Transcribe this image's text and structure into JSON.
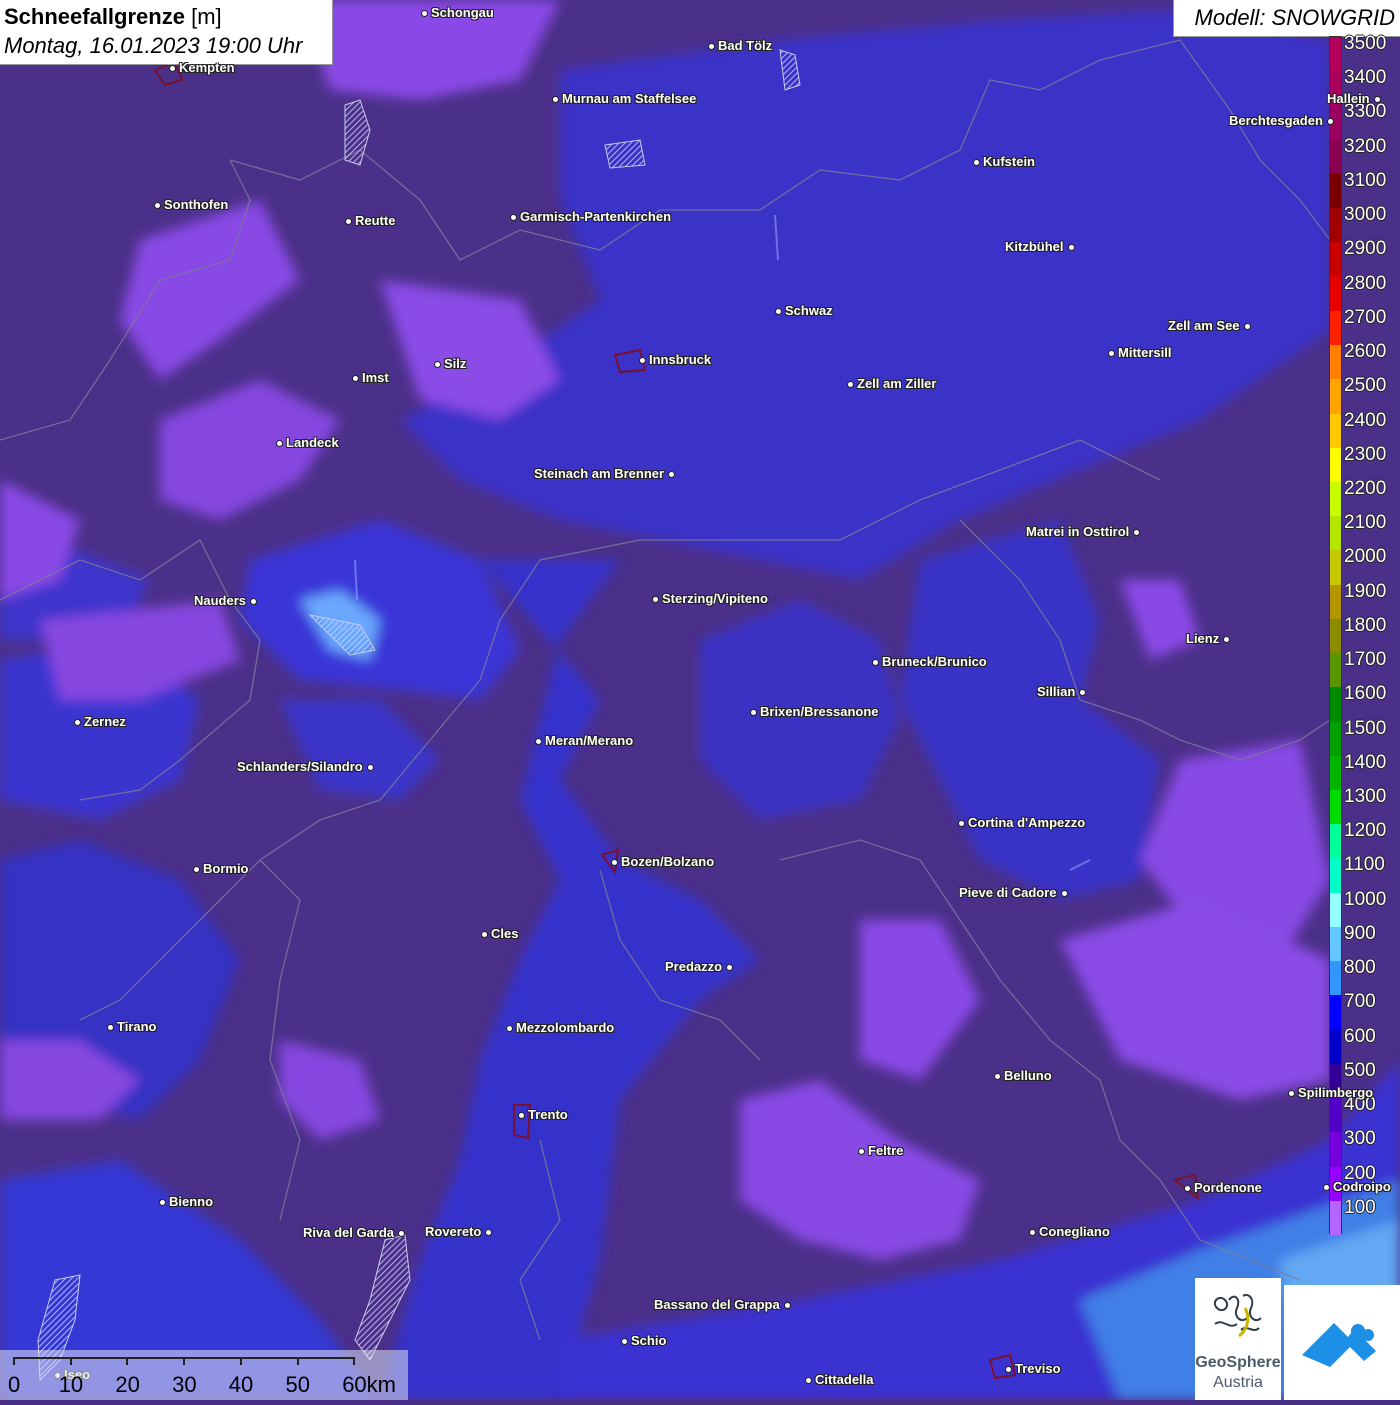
{
  "header": {
    "title_bold": "Schneefallgrenze",
    "title_unit": "[m]",
    "datetime": "Montag, 16.01.2023 19:00 Uhr"
  },
  "model_label": "Modell: SNOWGRID",
  "legend": {
    "values": [
      "3500",
      "3400",
      "3300",
      "3200",
      "3100",
      "3000",
      "2900",
      "2800",
      "2700",
      "2600",
      "2500",
      "2400",
      "2300",
      "2200",
      "2100",
      "2000",
      "1900",
      "1800",
      "1700",
      "1600",
      "1500",
      "1400",
      "1300",
      "1200",
      "1100",
      "1000",
      "900",
      "800",
      "700",
      "600",
      "500",
      "400",
      "300",
      "200",
      "100"
    ],
    "colors": [
      "#b4005a",
      "#a8005a",
      "#9a0060",
      "#8c0050",
      "#780000",
      "#a00000",
      "#c80000",
      "#e60000",
      "#ff2000",
      "#ff7f00",
      "#ffa500",
      "#ffc800",
      "#ffff00",
      "#c8ff00",
      "#b4e600",
      "#c8c800",
      "#b49600",
      "#8c8c00",
      "#5a9600",
      "#008c00",
      "#00a000",
      "#00b400",
      "#00dc00",
      "#00ff96",
      "#00ffc8",
      "#96ffff",
      "#64c8ff",
      "#3296ff",
      "#0000ff",
      "#0000c8",
      "#320096",
      "#5000c8",
      "#7800dc",
      "#9600ff",
      "#b464ff"
    ]
  },
  "cities": [
    {
      "name": "Schongau"
    },
    {
      "name": "Bad Tölz"
    },
    {
      "name": "Kempten"
    },
    {
      "name": "Murnau am Staffelsee"
    },
    {
      "name": "Hallein"
    },
    {
      "name": "Berchtesgaden"
    },
    {
      "name": "Kufstein"
    },
    {
      "name": "Sonthofen"
    },
    {
      "name": "Reutte"
    },
    {
      "name": "Garmisch-Partenkirchen"
    },
    {
      "name": "Kitzbühel"
    },
    {
      "name": "Schwaz"
    },
    {
      "name": "Zell am See"
    },
    {
      "name": "Innsbruck"
    },
    {
      "name": "Mittersill"
    },
    {
      "name": "Silz"
    },
    {
      "name": "Imst"
    },
    {
      "name": "Zell am Ziller"
    },
    {
      "name": "Landeck"
    },
    {
      "name": "Steinach am Brenner"
    },
    {
      "name": "Matrei in Osttirol"
    },
    {
      "name": "Nauders"
    },
    {
      "name": "Sterzing/Vipiteno"
    },
    {
      "name": "Lienz"
    },
    {
      "name": "Bruneck/Brunico"
    },
    {
      "name": "Sillian"
    },
    {
      "name": "Brixen/Bressanone"
    },
    {
      "name": "Zernez"
    },
    {
      "name": "Meran/Merano"
    },
    {
      "name": "Schlanders/Silandro"
    },
    {
      "name": "Cortina d'Ampezzo"
    },
    {
      "name": "Bozen/Bolzano"
    },
    {
      "name": "Bormio"
    },
    {
      "name": "Pieve di Cadore"
    },
    {
      "name": "Cles"
    },
    {
      "name": "Predazzo"
    },
    {
      "name": "Tirano"
    },
    {
      "name": "Mezzolombardo"
    },
    {
      "name": "Belluno"
    },
    {
      "name": "Spilimbergo"
    },
    {
      "name": "Trento"
    },
    {
      "name": "Feltre"
    },
    {
      "name": "Pordenone"
    },
    {
      "name": "Codroipo"
    },
    {
      "name": "Bienno"
    },
    {
      "name": "Riva del Garda"
    },
    {
      "name": "Rovereto"
    },
    {
      "name": "Conegliano"
    },
    {
      "name": "Bassano del Grappa"
    },
    {
      "name": "Schio"
    },
    {
      "name": "Iseo"
    },
    {
      "name": "Treviso"
    },
    {
      "name": "Cittadella"
    }
  ],
  "scale": {
    "labels": [
      "0",
      "10",
      "20",
      "30",
      "40",
      "50",
      "60km"
    ]
  },
  "logo": {
    "word1": "GeoSphere",
    "word2": "Austria"
  }
}
